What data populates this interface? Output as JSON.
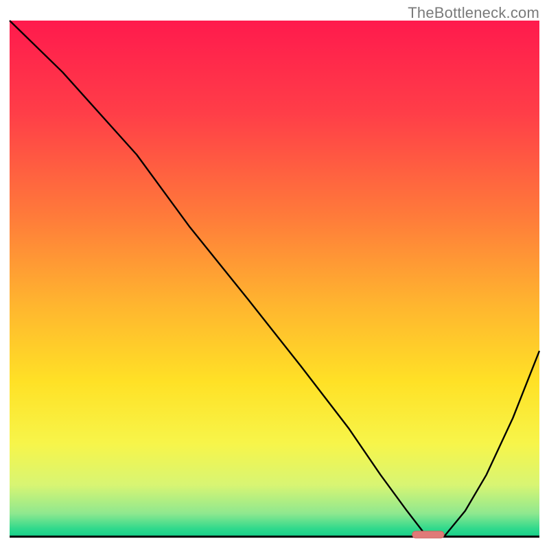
{
  "watermark": "TheBottleneck.com",
  "colors": {
    "gradient_stops": [
      {
        "offset": 0.0,
        "color": "#ff1a4d"
      },
      {
        "offset": 0.18,
        "color": "#ff3e48"
      },
      {
        "offset": 0.38,
        "color": "#ff7b3a"
      },
      {
        "offset": 0.55,
        "color": "#ffb52f"
      },
      {
        "offset": 0.7,
        "color": "#ffe126"
      },
      {
        "offset": 0.82,
        "color": "#f7f54a"
      },
      {
        "offset": 0.9,
        "color": "#d8f573"
      },
      {
        "offset": 0.955,
        "color": "#8fe88f"
      },
      {
        "offset": 0.985,
        "color": "#2fd98c"
      },
      {
        "offset": 1.0,
        "color": "#15cf8a"
      }
    ],
    "curve": "#000000",
    "axis": "#000000",
    "marker_fill": "#e07a78",
    "marker_stroke": "#cc6462"
  },
  "chart_data": {
    "type": "line",
    "title": "",
    "xlabel": "",
    "ylabel": "",
    "xlim": [
      0,
      100
    ],
    "ylim": [
      0,
      100
    ],
    "grid": false,
    "legend": false,
    "series": [
      {
        "name": "bottleneck-curve",
        "x": [
          0,
          10,
          24,
          34,
          45,
          55,
          64,
          70,
          75,
          78,
          82,
          86,
          90,
          95,
          100
        ],
        "values": [
          100,
          90,
          74,
          60,
          46,
          33,
          21,
          12,
          5,
          1,
          0,
          5,
          12,
          23,
          36
        ]
      }
    ],
    "marker": {
      "name": "recommended-range",
      "x_start": 76,
      "x_end": 82,
      "y": 0.4
    }
  }
}
